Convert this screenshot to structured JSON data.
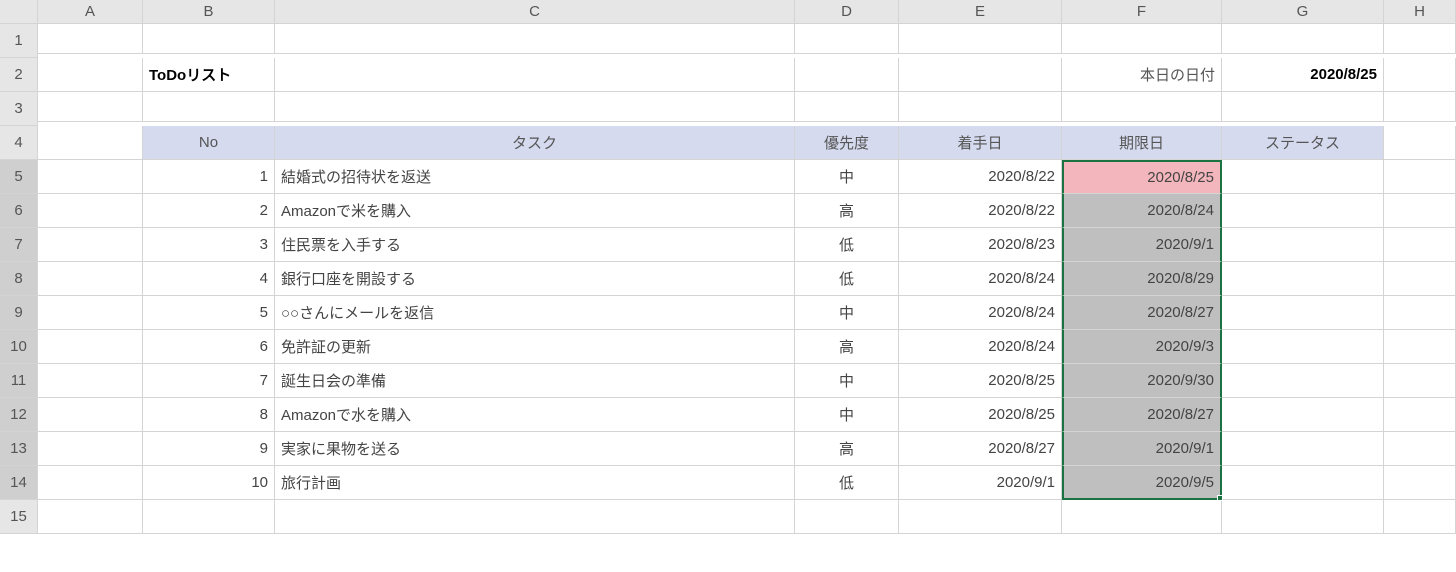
{
  "columns": [
    "",
    "A",
    "B",
    "C",
    "D",
    "E",
    "F",
    "G",
    "H"
  ],
  "row_labels": [
    "1",
    "2",
    "3",
    "4",
    "5",
    "6",
    "7",
    "8",
    "9",
    "10",
    "11",
    "12",
    "13",
    "14",
    "15"
  ],
  "title": "ToDoリスト",
  "today_label": "本日の日付",
  "today_date": "2020/8/25",
  "headers": {
    "no": "No",
    "task": "タスク",
    "priority": "優先度",
    "start": "着手日",
    "due": "期限日",
    "status": "ステータス"
  },
  "rows": [
    {
      "no": "1",
      "task": "結婚式の招待状を返送",
      "priority": "中",
      "start": "2020/8/22",
      "due": "2020/8/25"
    },
    {
      "no": "2",
      "task": "Amazonで米を購入",
      "priority": "高",
      "start": "2020/8/22",
      "due": "2020/8/24"
    },
    {
      "no": "3",
      "task": "住民票を入手する",
      "priority": "低",
      "start": "2020/8/23",
      "due": "2020/9/1"
    },
    {
      "no": "4",
      "task": "銀行口座を開設する",
      "priority": "低",
      "start": "2020/8/24",
      "due": "2020/8/29"
    },
    {
      "no": "5",
      "task": "○○さんにメールを返信",
      "priority": "中",
      "start": "2020/8/24",
      "due": "2020/8/27"
    },
    {
      "no": "6",
      "task": "免許証の更新",
      "priority": "高",
      "start": "2020/8/24",
      "due": "2020/9/3"
    },
    {
      "no": "7",
      "task": "誕生日会の準備",
      "priority": "中",
      "start": "2020/8/25",
      "due": "2020/9/30"
    },
    {
      "no": "8",
      "task": "Amazonで水を購入",
      "priority": "中",
      "start": "2020/8/25",
      "due": "2020/8/27"
    },
    {
      "no": "9",
      "task": "実家に果物を送る",
      "priority": "高",
      "start": "2020/8/27",
      "due": "2020/9/1"
    },
    {
      "no": "10",
      "task": "旅行計画",
      "priority": "低",
      "start": "2020/9/1",
      "due": "2020/9/5"
    }
  ]
}
